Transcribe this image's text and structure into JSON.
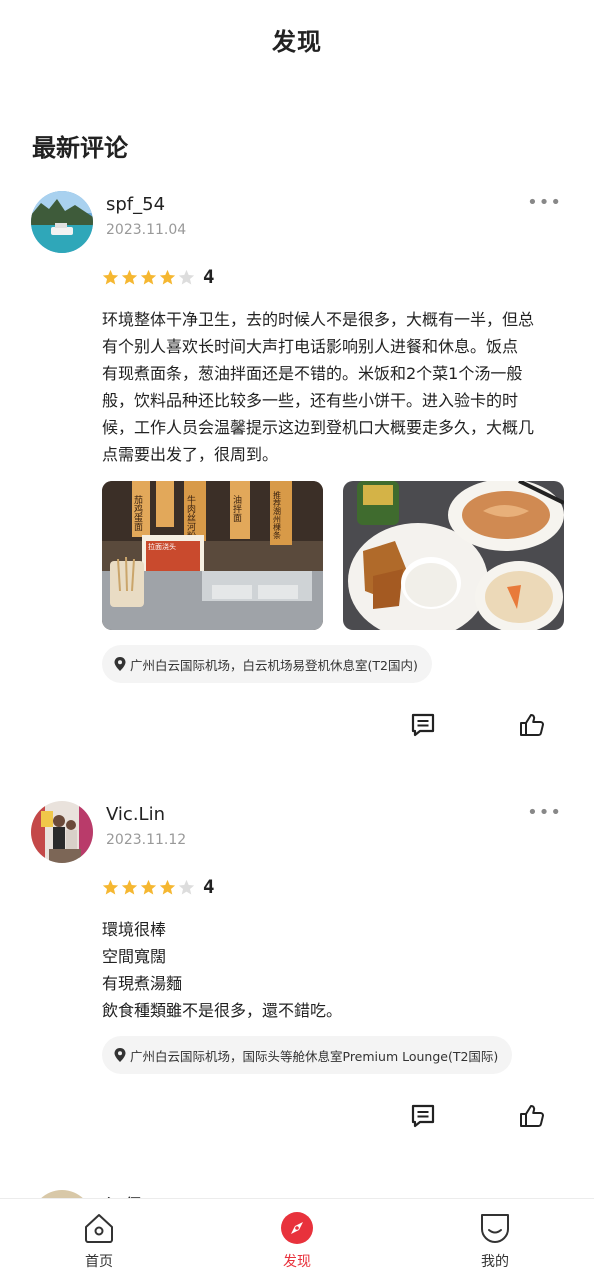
{
  "header": {
    "title": "发现"
  },
  "section": {
    "title": "最新评论"
  },
  "reviews": [
    {
      "username": "spf_54",
      "date": "2023.11.04",
      "rating": 4,
      "rating_text": "4",
      "content_lines": [
        "环境整体干净卫生，去的时候人不是很多，大概有一半，但总",
        "有个别人喜欢长时间大声打电话影响别人进餐和休息。饭点",
        "有现煮面条，葱油拌面还是不错的。米饭和2个菜1个汤一般",
        "般，饮料品种还比较多一些，还有些小饼干。进入验卡的时",
        "候，工作人员会温馨提示这边到登机口大概要走多久，大概几",
        "点需要出发了，很周到。"
      ],
      "photo_signs": [
        "茄鸡蛋面",
        "牛肉丝河粉",
        "油拌面",
        "推荐潮州棵条",
        "拉面浇头"
      ],
      "location": "广州白云国际机场，白云机场易登机休息室(T2国内)"
    },
    {
      "username": "Vic.Lin",
      "date": "2023.11.12",
      "rating": 4,
      "rating_text": "4",
      "content_lines": [
        "環境很棒",
        "空間寬闊",
        "有現煮湯麵",
        "飲食種類雖不是很多，還不錯吃。"
      ],
      "location": "广州白云国际机场，国际头等舱休息室Premium Lounge(T2国际)"
    }
  ],
  "partial_next": {
    "username": "江保"
  },
  "tabbar": {
    "items": [
      {
        "label": "首页",
        "icon": "home-icon"
      },
      {
        "label": "发现",
        "icon": "compass-icon",
        "active": true
      },
      {
        "label": "我的",
        "icon": "smiley-icon"
      }
    ]
  },
  "colors": {
    "accent": "#e8323c",
    "star": "#f5b731",
    "star_empty": "#dddddd"
  }
}
